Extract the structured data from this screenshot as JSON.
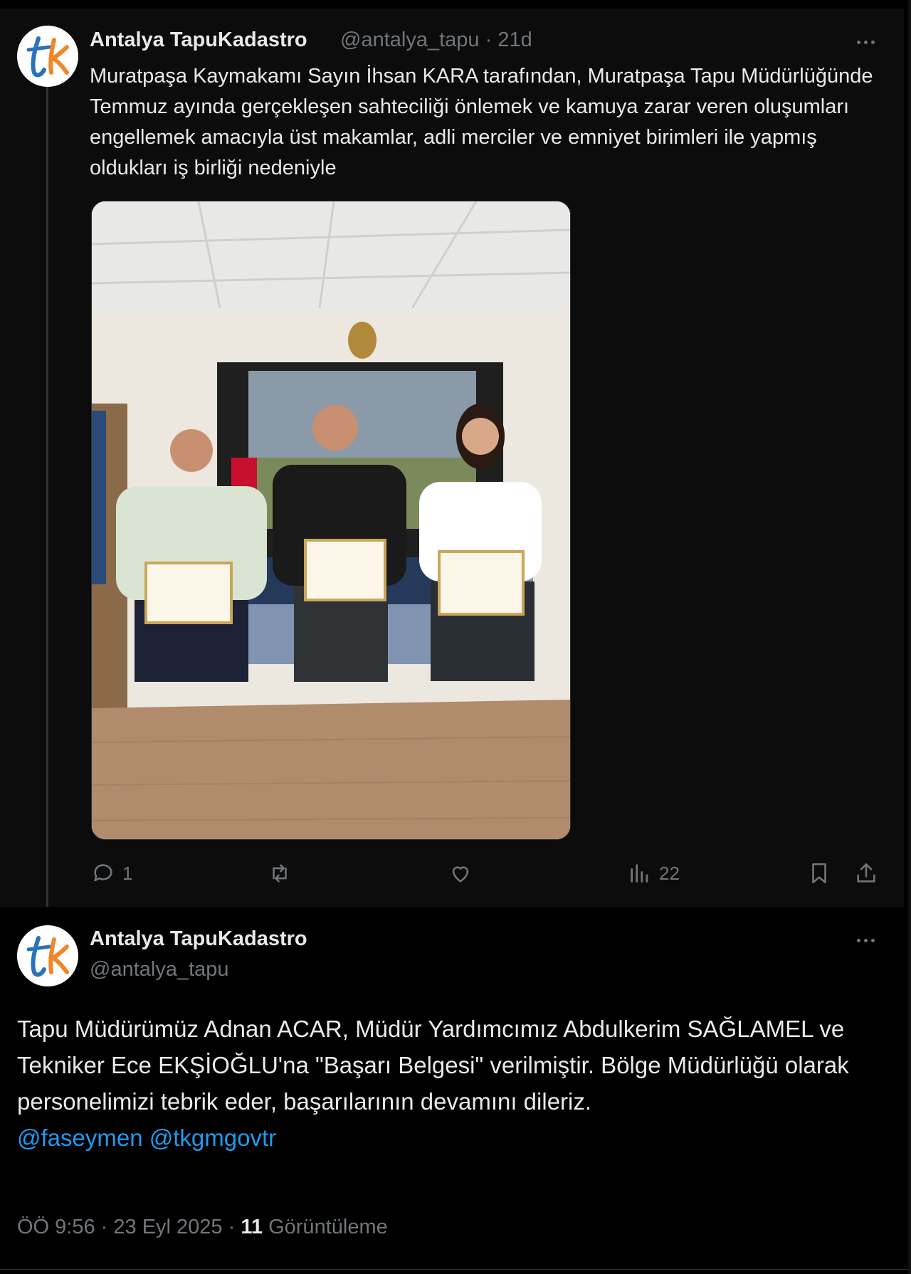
{
  "colors": {
    "background": "#000000",
    "text": "#e7e9ea",
    "muted": "#71767b",
    "link": "#1d9bf0"
  },
  "tweet1": {
    "author_name": "Antalya TapuKadastro",
    "handle": "@antalya_tapu",
    "separator": "·",
    "time": "21d",
    "text": "Muratpaşa Kaymakamı Sayın İhsan KARA tarafından, Muratpaşa Tapu Müdürlüğünde Temmuz ayında gerçekleşen sahteciliği önlemek ve kamuya zarar veren oluşumları engellemek amacıyla üst makamlar, adli merciler ve emniyet birimleri ile yapmış oldukları iş birliği nedeniyle",
    "actions": {
      "reply_count": "1",
      "retweet_count": "",
      "like_count": "",
      "views_count": "22"
    },
    "icons": [
      "reply-icon",
      "retweet-icon",
      "like-icon",
      "views-icon",
      "bookmark-icon",
      "share-icon"
    ]
  },
  "tweet2": {
    "author_name": "Antalya TapuKadastro",
    "handle": "@antalya_tapu",
    "text": "Tapu Müdürümüz Adnan ACAR,  Müdür Yardımcımız Abdulkerim SAĞLAMEL ve Tekniker Ece EKŞİOĞLU'na \"Başarı Belgesi\" verilmiştir. Bölge Müdürlüğü olarak personelimizi tebrik eder, başarılarının devamını dileriz.",
    "mentions": [
      "@faseymen",
      "@tkgmgovtr"
    ],
    "timestamp": "ÖÖ 9:56 · 23 Eyl 2025",
    "separator": "·",
    "views_count": "11",
    "views_label": "Görüntüleme"
  }
}
